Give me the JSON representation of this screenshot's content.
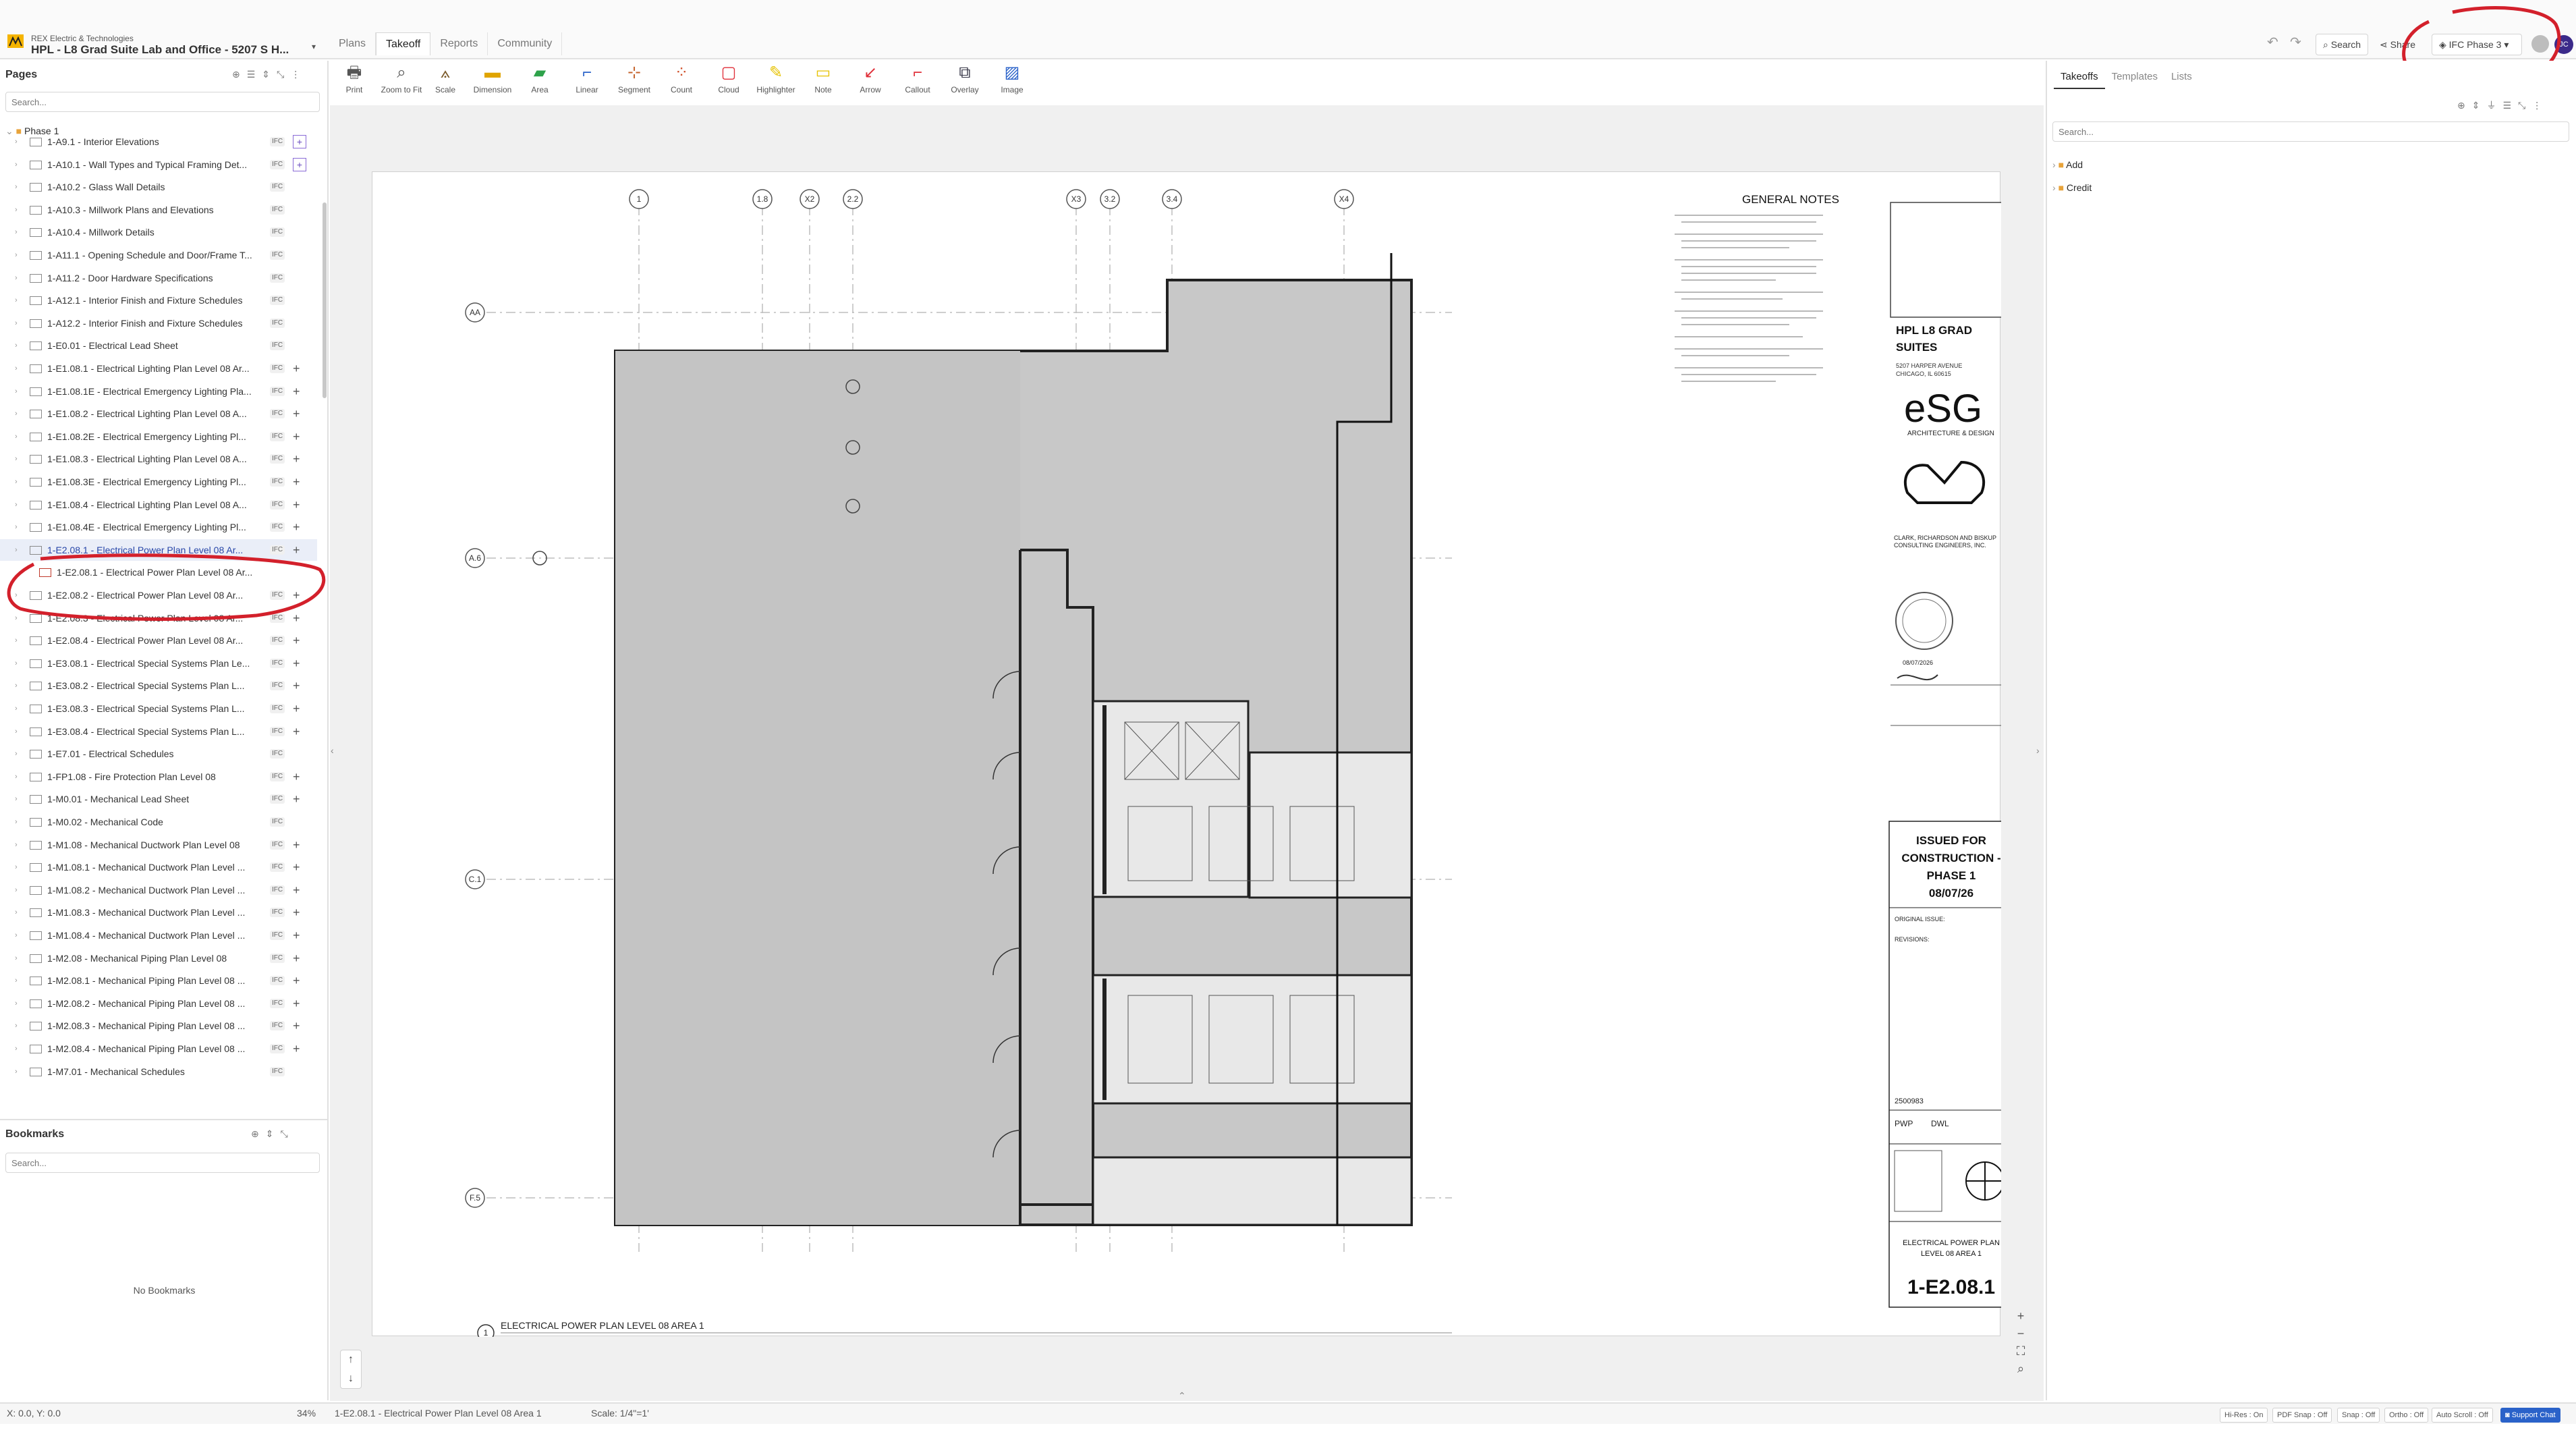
{
  "header": {
    "company": "REX Electric & Technologies",
    "project": "HPL - L8 Grad Suite Lab and Office - 5207 S H...",
    "tabs": [
      "Plans",
      "Takeoff",
      "Reports",
      "Community"
    ],
    "active_tab": "Takeoff",
    "search_label": "Search",
    "share_label": "Share",
    "phase_label": "IFC Phase 3",
    "avatar_initials": "JC"
  },
  "toolbar": {
    "tools": [
      {
        "label": "Print",
        "icon": "printer-icon"
      },
      {
        "label": "Zoom to Fit",
        "icon": "zoom-fit-icon"
      },
      {
        "label": "Scale",
        "icon": "scale-icon"
      },
      {
        "label": "Dimension",
        "icon": "dimension-icon"
      },
      {
        "label": "Area",
        "icon": "area-icon"
      },
      {
        "label": "Linear",
        "icon": "linear-icon"
      },
      {
        "label": "Segment",
        "icon": "segment-icon"
      },
      {
        "label": "Count",
        "icon": "count-icon"
      },
      {
        "label": "Cloud",
        "icon": "cloud-icon"
      },
      {
        "label": "Highlighter",
        "icon": "highlighter-icon"
      },
      {
        "label": "Note",
        "icon": "note-icon"
      },
      {
        "label": "Arrow",
        "icon": "arrow-icon"
      },
      {
        "label": "Callout",
        "icon": "callout-icon"
      },
      {
        "label": "Overlay",
        "icon": "overlay-icon"
      },
      {
        "label": "Image",
        "icon": "image-icon"
      }
    ]
  },
  "pages_panel": {
    "title": "Pages",
    "search_placeholder": "Search...",
    "folder": "Phase 1",
    "items": [
      {
        "label": "1-A9.1 - Interior Elevations",
        "badge": "IFC",
        "plus": "boxed"
      },
      {
        "label": "1-A10.1 - Wall Types and Typical Framing Det...",
        "badge": "IFC",
        "plus": "boxed"
      },
      {
        "label": "1-A10.2 - Glass Wall Details",
        "badge": "IFC",
        "plus": "none"
      },
      {
        "label": "1-A10.3 - Millwork Plans and Elevations",
        "badge": "IFC",
        "plus": "none"
      },
      {
        "label": "1-A10.4 - Millwork Details",
        "badge": "IFC",
        "plus": "none"
      },
      {
        "label": "1-A11.1 - Opening Schedule and Door/Frame T...",
        "badge": "IFC",
        "plus": "none"
      },
      {
        "label": "1-A11.2 - Door Hardware Specifications",
        "badge": "IFC",
        "plus": "none"
      },
      {
        "label": "1-A12.1 - Interior Finish and Fixture Schedules",
        "badge": "IFC",
        "plus": "none"
      },
      {
        "label": "1-A12.2 - Interior Finish and Fixture Schedules",
        "badge": "IFC",
        "plus": "none"
      },
      {
        "label": "1-E0.01 - Electrical Lead Sheet",
        "badge": "IFC",
        "plus": "none"
      },
      {
        "label": "1-E1.08.1 - Electrical Lighting Plan Level 08 Ar...",
        "badge": "IFC",
        "plus": "plain"
      },
      {
        "label": "1-E1.08.1E - Electrical Emergency Lighting Pla...",
        "badge": "IFC",
        "plus": "plain"
      },
      {
        "label": "1-E1.08.2 - Electrical Lighting Plan Level 08 A...",
        "badge": "IFC",
        "plus": "plain"
      },
      {
        "label": "1-E1.08.2E - Electrical Emergency Lighting Pl...",
        "badge": "IFC",
        "plus": "plain"
      },
      {
        "label": "1-E1.08.3 - Electrical Lighting Plan Level 08 A...",
        "badge": "IFC",
        "plus": "plain"
      },
      {
        "label": "1-E1.08.3E - Electrical Emergency Lighting Pl...",
        "badge": "IFC",
        "plus": "plain"
      },
      {
        "label": "1-E1.08.4 - Electrical Lighting Plan Level 08 A...",
        "badge": "IFC",
        "plus": "plain"
      },
      {
        "label": "1-E1.08.4E - Electrical Emergency Lighting Pl...",
        "badge": "IFC",
        "plus": "plain"
      },
      {
        "label": "1-E2.08.1 - Electrical Power Plan Level 08 Ar...",
        "badge": "IFC",
        "plus": "plain",
        "selected": true
      },
      {
        "label": "1-E2.08.1 - Electrical Power Plan Level 08 Ar...",
        "badge": "",
        "plus": "none",
        "child": true
      },
      {
        "label": "1-E2.08.2 - Electrical Power Plan Level 08 Ar...",
        "badge": "IFC",
        "plus": "plain"
      },
      {
        "label": "1-E2.08.3 - Electrical Power Plan Level 08 Ar...",
        "badge": "IFC",
        "plus": "plain"
      },
      {
        "label": "1-E2.08.4 - Electrical Power Plan Level 08 Ar...",
        "badge": "IFC",
        "plus": "plain"
      },
      {
        "label": "1-E3.08.1 - Electrical Special Systems Plan Le...",
        "badge": "IFC",
        "plus": "plain"
      },
      {
        "label": "1-E3.08.2 - Electrical Special Systems Plan L...",
        "badge": "IFC",
        "plus": "plain"
      },
      {
        "label": "1-E3.08.3 - Electrical Special Systems Plan L...",
        "badge": "IFC",
        "plus": "plain"
      },
      {
        "label": "1-E3.08.4 - Electrical Special Systems Plan L...",
        "badge": "IFC",
        "plus": "plain"
      },
      {
        "label": "1-E7.01 - Electrical Schedules",
        "badge": "IFC",
        "plus": "none"
      },
      {
        "label": "1-FP1.08 - Fire Protection Plan Level 08",
        "badge": "IFC",
        "plus": "plain"
      },
      {
        "label": "1-M0.01 - Mechanical Lead Sheet",
        "badge": "IFC",
        "plus": "plain"
      },
      {
        "label": "1-M0.02 - Mechanical Code",
        "badge": "IFC",
        "plus": "none"
      },
      {
        "label": "1-M1.08 - Mechanical Ductwork Plan Level 08",
        "badge": "IFC",
        "plus": "plain"
      },
      {
        "label": "1-M1.08.1 - Mechanical Ductwork Plan Level ...",
        "badge": "IFC",
        "plus": "plain"
      },
      {
        "label": "1-M1.08.2 - Mechanical Ductwork Plan Level ...",
        "badge": "IFC",
        "plus": "plain"
      },
      {
        "label": "1-M1.08.3 - Mechanical Ductwork Plan Level ...",
        "badge": "IFC",
        "plus": "plain"
      },
      {
        "label": "1-M1.08.4 - Mechanical Ductwork Plan Level ...",
        "badge": "IFC",
        "plus": "plain"
      },
      {
        "label": "1-M2.08 - Mechanical Piping Plan Level 08",
        "badge": "IFC",
        "plus": "plain"
      },
      {
        "label": "1-M2.08.1 - Mechanical Piping Plan Level 08 ...",
        "badge": "IFC",
        "plus": "plain"
      },
      {
        "label": "1-M2.08.2 - Mechanical Piping Plan Level 08 ...",
        "badge": "IFC",
        "plus": "plain"
      },
      {
        "label": "1-M2.08.3 - Mechanical Piping Plan Level 08 ...",
        "badge": "IFC",
        "plus": "plain"
      },
      {
        "label": "1-M2.08.4 - Mechanical Piping Plan Level 08 ...",
        "badge": "IFC",
        "plus": "plain"
      },
      {
        "label": "1-M7.01 - Mechanical Schedules",
        "badge": "IFC",
        "plus": "none"
      }
    ]
  },
  "bookmarks_panel": {
    "title": "Bookmarks",
    "search_placeholder": "Search...",
    "empty_text": "No Bookmarks"
  },
  "right_panel": {
    "tabs": [
      "Takeoffs",
      "Templates",
      "Lists"
    ],
    "active_tab": "Takeoffs",
    "search_placeholder": "Search...",
    "folders": [
      "Add",
      "Credit"
    ]
  },
  "sheet": {
    "grid_top": [
      "1",
      "1.8",
      "X2",
      "2.2",
      "X3",
      "3.2",
      "3.4",
      "X4"
    ],
    "grid_left": [
      "AA",
      "A.6",
      "C.1",
      "F.5"
    ],
    "general_notes_title": "GENERAL NOTES",
    "plan_title": "ELECTRICAL POWER PLAN LEVEL 08 AREA 1",
    "plan_number": "1",
    "title_block": {
      "project_name": "HPL L8 GRAD SUITES",
      "project_address": "5207 HARPER AVENUE CHICAGO, IL 60615",
      "architect_logo": "eSG",
      "architect_sub": "ARCHITECTURE & DESIGN",
      "engineer": "CLARK, RICHARDSON AND BISKUP CONSULTING ENGINEERS, INC.",
      "stamp_date": "08/07/2026",
      "issued_for": "ISSUED FOR CONSTRUCTION - PHASE 1 08/07/26",
      "original_issue_label": "ORIGINAL ISSUE:",
      "revisions_label": "REVISIONS:",
      "project_number": "2500983",
      "drawn_by": "PWP",
      "checked_by": "DWL",
      "sheet_title": "ELECTRICAL POWER PLAN LEVEL 08 AREA 1",
      "sheet_number": "1-E2.08.1"
    }
  },
  "statusbar": {
    "coords": "X: 0.0, Y: 0.0",
    "zoom": "34%",
    "page": "1-E2.08.1 - Electrical Power Plan Level 08 Area 1",
    "scale": "Scale: 1/4\"=1'",
    "toggles": [
      "Hi-Res : On",
      "PDF Snap : Off",
      "Snap : Off",
      "Ortho : Off",
      "Auto Scroll : Off"
    ],
    "support": "Support Chat"
  },
  "colors": {
    "accent": "#2846a8",
    "annotation": "#d3202b",
    "floor_fill": "#c8c8c8"
  }
}
